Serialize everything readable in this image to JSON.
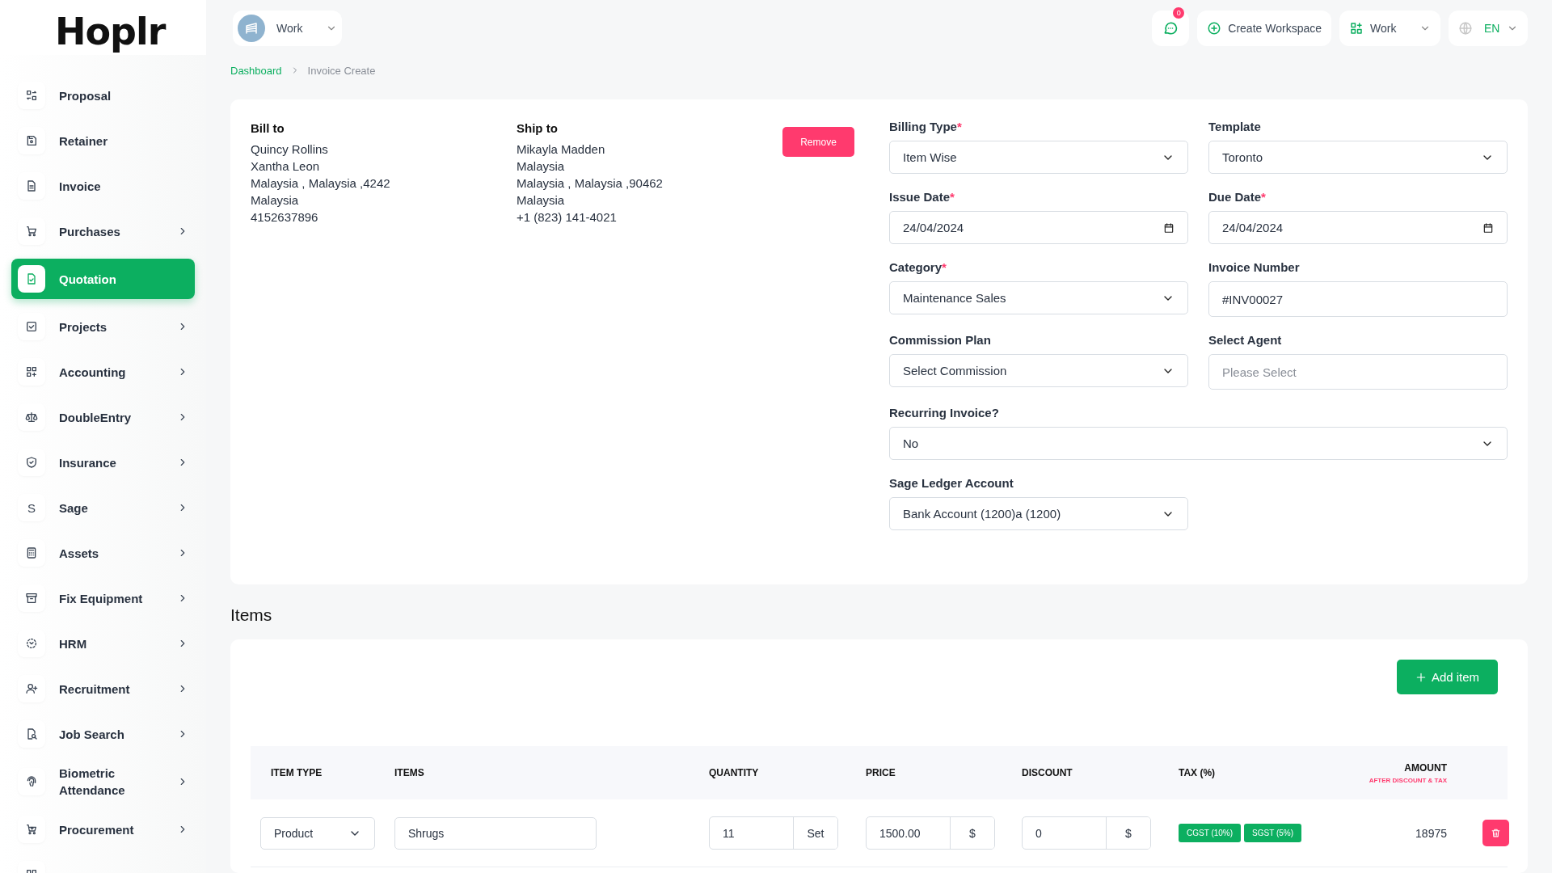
{
  "logo": {
    "text": "Hoplr"
  },
  "sidebar": {
    "items": [
      {
        "label": "Proposal",
        "expandable": false,
        "selected": false
      },
      {
        "label": "Retainer",
        "expandable": false,
        "selected": false
      },
      {
        "label": "Invoice",
        "expandable": false,
        "selected": false
      },
      {
        "label": "Purchases",
        "expandable": true,
        "selected": false
      },
      {
        "label": "Quotation",
        "expandable": false,
        "selected": true
      },
      {
        "label": "Projects",
        "expandable": true,
        "selected": false
      },
      {
        "label": "Accounting",
        "expandable": true,
        "selected": false
      },
      {
        "label": "DoubleEntry",
        "expandable": true,
        "selected": false
      },
      {
        "label": "Insurance",
        "expandable": true,
        "selected": false
      },
      {
        "label": "Sage",
        "icon_text": "S",
        "expandable": true,
        "selected": false
      },
      {
        "label": "Assets",
        "expandable": true,
        "selected": false
      },
      {
        "label": "Fix Equipment",
        "expandable": true,
        "selected": false
      },
      {
        "label": "HRM",
        "expandable": true,
        "selected": false
      },
      {
        "label": "Recruitment",
        "expandable": true,
        "selected": false
      },
      {
        "label": "Job Search",
        "expandable": true,
        "selected": false
      },
      {
        "label": "Biometric Attendance",
        "expandable": true,
        "selected": false
      },
      {
        "label": "Procurement",
        "expandable": true,
        "selected": false
      },
      {
        "expandable": false,
        "selected": false
      }
    ]
  },
  "header": {
    "workspace": "Work",
    "messages_badge": "0",
    "create_workspace": "Create Workspace",
    "workspace_menu": "Work",
    "language": "EN"
  },
  "breadcrumb": [
    {
      "label": "Dashboard",
      "link": true
    },
    {
      "label": "Invoice Create",
      "link": false
    }
  ],
  "bill_to": {
    "title": "Bill to",
    "lines": [
      "Quincy Rollins",
      "Xantha Leon",
      "Malaysia , Malaysia ,4242",
      "Malaysia",
      "4152637896"
    ]
  },
  "ship_to": {
    "title": "Ship to",
    "lines": [
      "Mikayla Madden",
      "Malaysia",
      "Malaysia , Malaysia ,90462",
      "Malaysia",
      "+1 (823) 141-4021"
    ]
  },
  "remove_button": "Remove",
  "required_mark": "*",
  "form": [
    {
      "kind": "select",
      "label": "Billing Type",
      "required": true,
      "value": "Item Wise",
      "wide": false
    },
    {
      "kind": "select",
      "label": "Template",
      "required": false,
      "value": "Toronto",
      "wide": false
    },
    {
      "kind": "date",
      "label": "Issue Date",
      "required": true,
      "value": "24/04/2024",
      "wide": false
    },
    {
      "kind": "date",
      "label": "Due Date",
      "required": true,
      "value": "24/04/2024",
      "wide": false
    },
    {
      "kind": "select",
      "label": "Category",
      "required": true,
      "value": "Maintenance Sales",
      "wide": false
    },
    {
      "kind": "text",
      "label": "Invoice Number",
      "required": false,
      "value": "#INV00027",
      "wide": false
    },
    {
      "kind": "select",
      "label": "Commission Plan",
      "required": false,
      "value": "Select Commission",
      "wide": false
    },
    {
      "kind": "text",
      "label": "Select Agent",
      "required": false,
      "placeholder": "Please Select",
      "wide": false
    },
    {
      "kind": "select",
      "label": "Recurring Invoice?",
      "required": false,
      "value": "No",
      "wide": true
    },
    {
      "kind": "select",
      "label": "Sage Ledger Account",
      "required": false,
      "value": "Bank Account (1200)a (1200)",
      "wide": false
    }
  ],
  "items_title": "Items",
  "add_item": "Add item",
  "table": {
    "columns": [
      "ITEM TYPE",
      "ITEMS",
      "QUANTITY",
      "PRICE",
      "DISCOUNT",
      "TAX (%)",
      "AMOUNT"
    ],
    "amount_note": "AFTER DISCOUNT & TAX",
    "rows": [
      {
        "item_type": "Product",
        "item": "Shrugs",
        "quantity": "11",
        "unit": "Set",
        "price": "1500.00",
        "price_currency": "$",
        "discount": "0",
        "discount_currency": "$",
        "taxes": [
          "CGST (10%)",
          "SGST (5%)"
        ],
        "amount": "18975"
      }
    ]
  }
}
